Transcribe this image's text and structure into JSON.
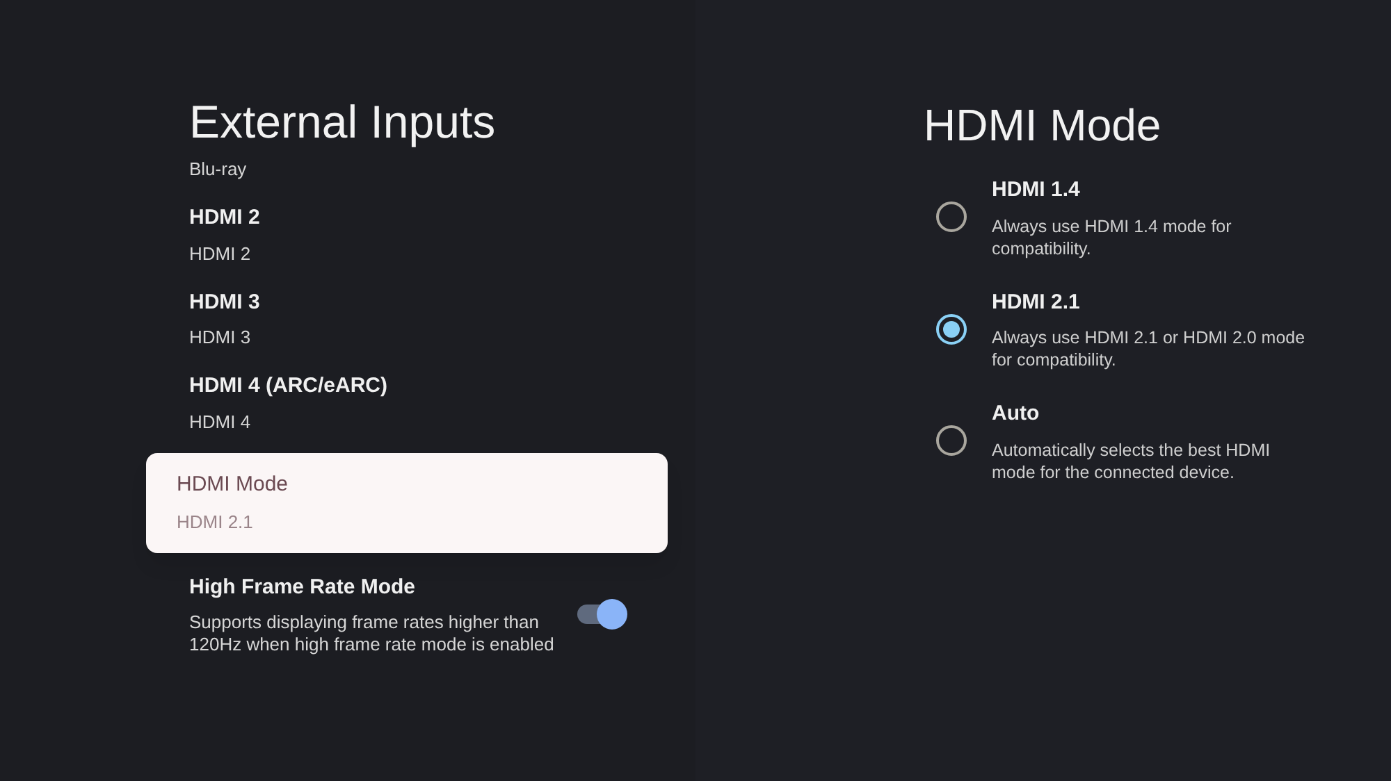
{
  "left_panel": {
    "title": "External Inputs",
    "items": [
      {
        "kind": "input",
        "subtitle": "Blu-ray",
        "focused": false
      },
      {
        "kind": "input",
        "title": "HDMI 2",
        "subtitle": "HDMI 2",
        "focused": false
      },
      {
        "kind": "input",
        "title": "HDMI 3",
        "subtitle": "HDMI 3",
        "focused": false
      },
      {
        "kind": "input",
        "title": "HDMI 4 (ARC/eARC)",
        "subtitle": "HDMI 4",
        "focused": false
      },
      {
        "kind": "input",
        "title": "HDMI Mode",
        "subtitle": "HDMI 2.1",
        "focused": true
      },
      {
        "kind": "toggle",
        "title": "High Frame Rate Mode",
        "subtitle": "Supports displaying frame rates higher than 120Hz when high frame rate mode is enabled",
        "focused": false,
        "on": true
      }
    ]
  },
  "right_panel": {
    "title": "HDMI Mode",
    "options": [
      {
        "label": "HDMI 1.4",
        "description": "Always use HDMI 1.4 mode for compatibility.",
        "selected": false
      },
      {
        "label": "HDMI 2.1",
        "description": "Always use HDMI 2.1 or HDMI 2.0 mode for compatibility.",
        "selected": true
      },
      {
        "label": "Auto",
        "description": "Automatically selects the best HDMI mode for the connected device.",
        "selected": false
      }
    ]
  }
}
